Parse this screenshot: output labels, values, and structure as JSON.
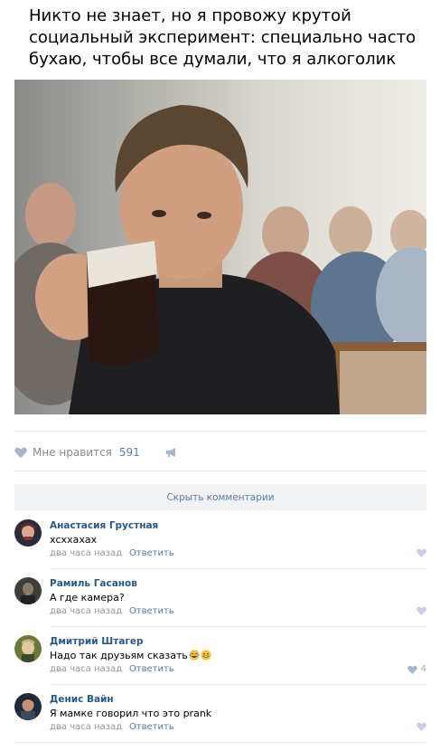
{
  "post": {
    "text": "Никто не знает, но я провожу крутой социальный эксперимент: специально часто бухаю, чтобы все думали, что я алкоголик"
  },
  "likes": {
    "label": "Мне нравится",
    "count": "591"
  },
  "comments_toggle": "Скрыть комментарии",
  "comments": [
    {
      "author": "Анастасия Грустная",
      "text": "хсххахах",
      "time": "два часа назад",
      "reply": "Ответить",
      "likes": ""
    },
    {
      "author": "Рамиль Гасанов",
      "text": "А где камера?",
      "time": "два часа назад",
      "reply": "Ответить",
      "likes": ""
    },
    {
      "author": "Дмитрий Штагер",
      "text": "Надо так друзьям сказать",
      "time": "два часа назад",
      "reply": "Ответить",
      "likes": "4"
    },
    {
      "author": "Денис Вайн",
      "text": "Я мамке говорил что это prank",
      "time": "два часа назад",
      "reply": "Ответить",
      "likes": ""
    }
  ],
  "colors": {
    "link": "#2a5885",
    "accent": "#5b7ba6",
    "meta": "#939393",
    "panel": "#f0f2f5"
  },
  "icons": [
    "heart-icon",
    "megaphone-icon",
    "laughing-emoji",
    "grinning-emoji"
  ]
}
